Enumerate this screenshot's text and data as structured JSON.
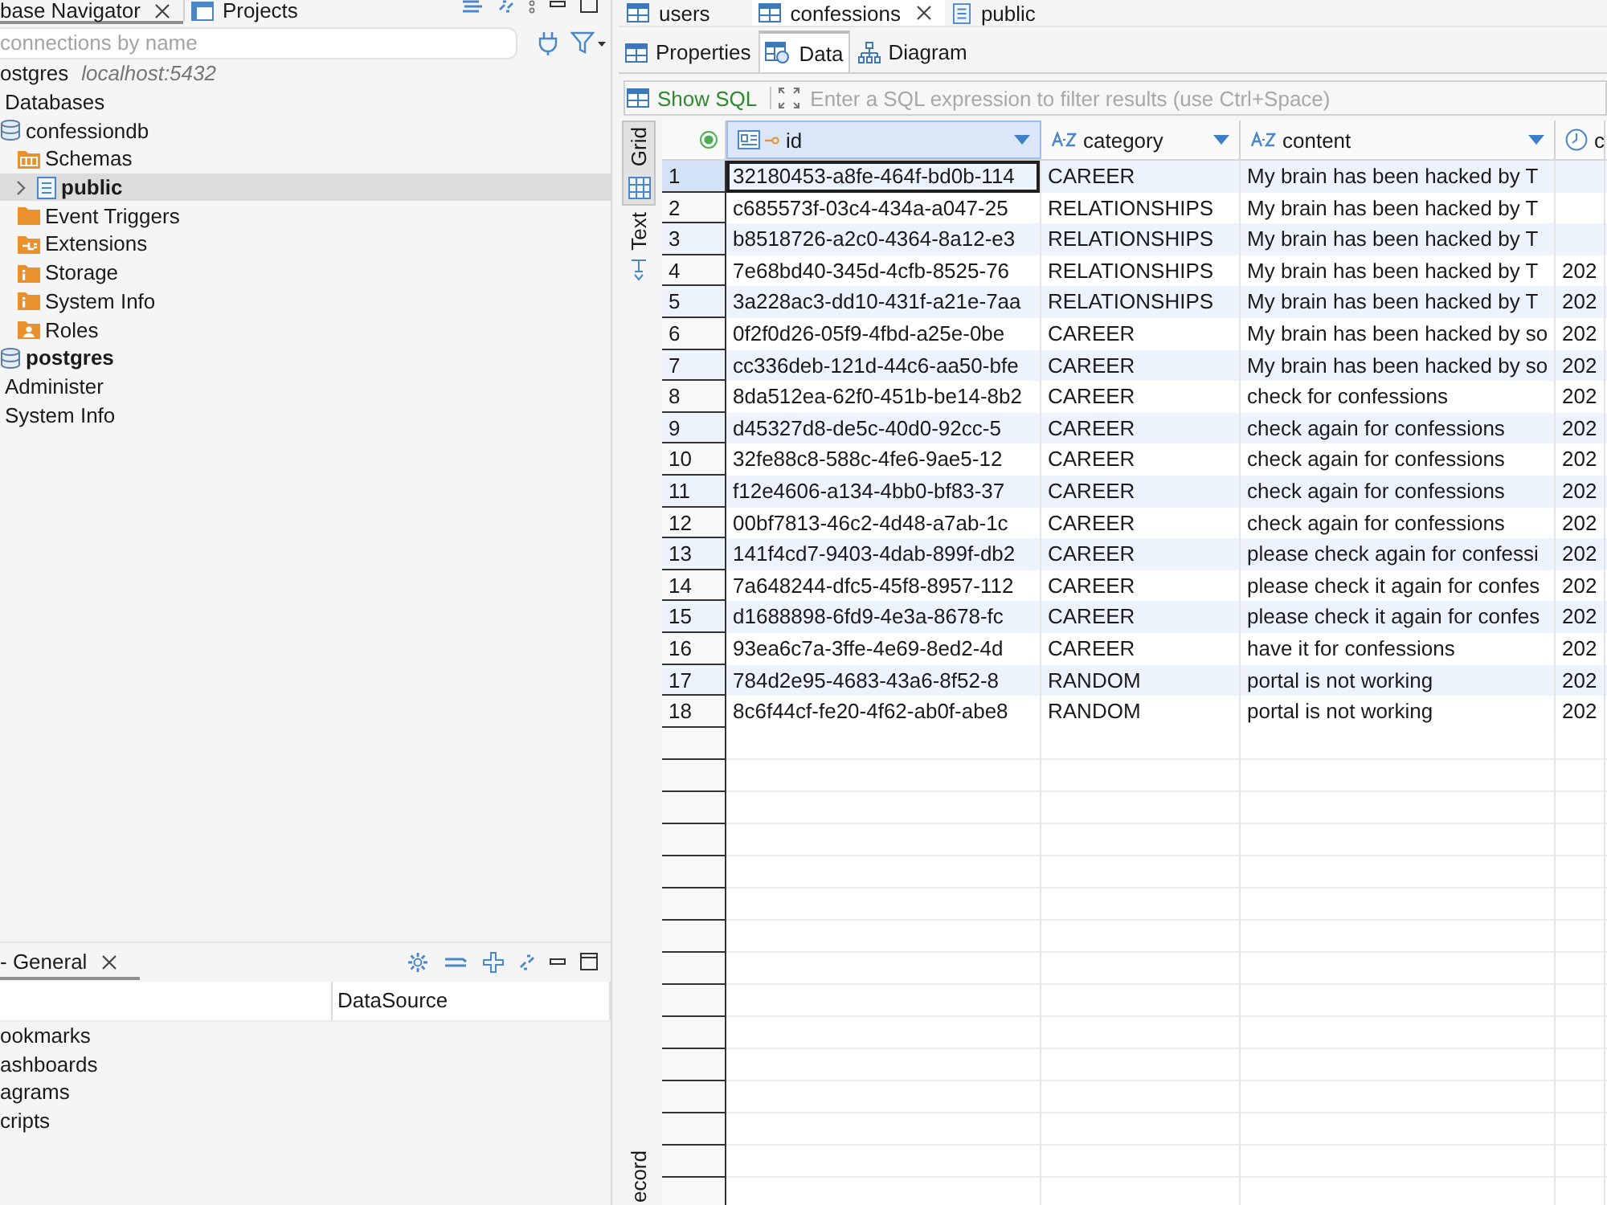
{
  "navigator": {
    "tabs": [
      {
        "label": "base Navigator",
        "kind": "navigator",
        "selected": true,
        "closable": true
      },
      {
        "label": "Projects",
        "kind": "projects",
        "selected": false,
        "closable": false
      }
    ],
    "search": {
      "placeholder": "connections by name"
    },
    "tree": [
      {
        "label": "ostgres",
        "detail": "localhost:5432",
        "selected": false,
        "active": false,
        "children": [
          {
            "label": "Databases",
            "selected": false,
            "active": false,
            "children": [
              {
                "label": "confessiondb",
                "kind": "database",
                "selected": false,
                "active": false,
                "children": [
                  {
                    "label": "Schemas",
                    "kind": "schemas",
                    "selected": false,
                    "active": false,
                    "children": [
                      {
                        "label": "public",
                        "kind": "schema",
                        "selected": true,
                        "active": true,
                        "expanded": false
                      }
                    ]
                  },
                  {
                    "label": "Event Triggers",
                    "kind": "folder",
                    "selected": false,
                    "active": false
                  },
                  {
                    "label": "Extensions",
                    "kind": "extensions",
                    "selected": false,
                    "active": false
                  },
                  {
                    "label": "Storage",
                    "kind": "info",
                    "selected": false,
                    "active": false
                  },
                  {
                    "label": "System Info",
                    "kind": "info",
                    "selected": false,
                    "active": false
                  },
                  {
                    "label": "Roles",
                    "kind": "roles",
                    "selected": false,
                    "active": false
                  }
                ]
              },
              {
                "label": "postgres",
                "kind": "database",
                "selected": false,
                "active": true
              }
            ]
          },
          {
            "label": "Administer",
            "selected": false,
            "active": false
          },
          {
            "label": "System Info",
            "selected": false,
            "active": false
          }
        ]
      }
    ]
  },
  "projects": {
    "tab": {
      "label": "- General",
      "selected": true,
      "closable": true
    },
    "column_2": "DataSource",
    "rows": [
      "ookmarks",
      "ashboards",
      "agrams",
      "cripts"
    ]
  },
  "editor": {
    "tabs": [
      {
        "label": "users",
        "kind": "table",
        "selected": false,
        "closable": false
      },
      {
        "label": "confessions",
        "kind": "table",
        "selected": true,
        "closable": true
      },
      {
        "label": "public",
        "kind": "schema",
        "selected": false,
        "closable": false
      }
    ],
    "view_tabs": [
      {
        "label": "Properties",
        "kind": "properties",
        "selected": false
      },
      {
        "label": "Data",
        "kind": "data",
        "selected": true
      },
      {
        "label": "Diagram",
        "kind": "diagram",
        "selected": false
      }
    ],
    "filter": {
      "button": "Show SQL",
      "placeholder": "Enter a SQL expression to filter results (use Ctrl+Space)"
    },
    "side_tabs": [
      {
        "label": "Grid",
        "kind": "grid",
        "selected": true
      },
      {
        "label": "Text",
        "kind": "text",
        "selected": false
      },
      {
        "label": "ecord",
        "kind": "record",
        "selected": false
      }
    ],
    "table": {
      "columns": [
        {
          "label": "id",
          "kind": "uuid",
          "primary_key": true,
          "selected": true
        },
        {
          "label": "category",
          "kind": "text",
          "primary_key": false,
          "selected": false
        },
        {
          "label": "content",
          "kind": "text",
          "primary_key": false,
          "selected": false
        },
        {
          "label": "c",
          "kind": "timestamp",
          "primary_key": false,
          "selected": false
        }
      ],
      "rows": [
        {
          "number": "1",
          "selected": true,
          "cells": [
            "32180453-a8fe-464f-bd0b-114",
            "CAREER",
            "My brain has been hacked by T"
          ]
        },
        {
          "number": "2",
          "selected": false,
          "cells": [
            "c685573f-03c4-434a-a047-25",
            "RELATIONSHIPS",
            "My brain has been hacked by T"
          ]
        },
        {
          "number": "3",
          "selected": false,
          "cells": [
            "b8518726-a2c0-4364-8a12-e3",
            "RELATIONSHIPS",
            "My brain has been hacked by T"
          ]
        },
        {
          "number": "4",
          "selected": false,
          "cells": [
            "7e68bd40-345d-4cfb-8525-76",
            "RELATIONSHIPS",
            "My brain has been hacked by T",
            "202"
          ]
        },
        {
          "number": "5",
          "selected": false,
          "cells": [
            "3a228ac3-dd10-431f-a21e-7aa",
            "RELATIONSHIPS",
            "My brain has been hacked by T",
            "202"
          ]
        },
        {
          "number": "6",
          "selected": false,
          "cells": [
            "0f2f0d26-05f9-4fbd-a25e-0be",
            "CAREER",
            "My brain has been hacked by so",
            "202"
          ]
        },
        {
          "number": "7",
          "selected": false,
          "cells": [
            "cc336deb-121d-44c6-aa50-bfe",
            "CAREER",
            "My brain has been hacked by so",
            "202"
          ]
        },
        {
          "number": "8",
          "selected": false,
          "cells": [
            "8da512ea-62f0-451b-be14-8b2",
            "CAREER",
            "check for confessions",
            "202"
          ]
        },
        {
          "number": "9",
          "selected": false,
          "cells": [
            "d45327d8-de5c-40d0-92cc-5",
            "CAREER",
            "check again for confessions",
            "202"
          ]
        },
        {
          "number": "10",
          "selected": false,
          "cells": [
            "32fe88c8-588c-4fe6-9ae5-12",
            "CAREER",
            "check again for confessions",
            "202"
          ]
        },
        {
          "number": "11",
          "selected": false,
          "cells": [
            "f12e4606-a134-4bb0-bf83-37",
            "CAREER",
            "check again for confessions",
            "202"
          ]
        },
        {
          "number": "12",
          "selected": false,
          "cells": [
            "00bf7813-46c2-4d48-a7ab-1c",
            "CAREER",
            "check again for confessions",
            "202"
          ]
        },
        {
          "number": "13",
          "selected": false,
          "cells": [
            "141f4cd7-9403-4dab-899f-db2",
            "CAREER",
            "please check again for confessi",
            "202"
          ]
        },
        {
          "number": "14",
          "selected": false,
          "cells": [
            "7a648244-dfc5-45f8-8957-112",
            "CAREER",
            "please check it again for confes",
            "202"
          ]
        },
        {
          "number": "15",
          "selected": false,
          "cells": [
            "d1688898-6fd9-4e3a-8678-fc",
            "CAREER",
            "please check it again for confes",
            "202"
          ]
        },
        {
          "number": "16",
          "selected": false,
          "cells": [
            "93ea6c7a-3ffe-4e69-8ed2-4d",
            "CAREER",
            "have it for confessions",
            "202"
          ]
        },
        {
          "number": "17",
          "selected": false,
          "cells": [
            "784d2e95-4683-43a6-8f52-8",
            "RANDOM",
            "portal is not working",
            "202"
          ]
        },
        {
          "number": "18",
          "selected": false,
          "cells": [
            "8c6f44cf-fe20-4f62-ab0f-abe8",
            "RANDOM",
            "portal is not working",
            "202"
          ]
        }
      ]
    }
  }
}
